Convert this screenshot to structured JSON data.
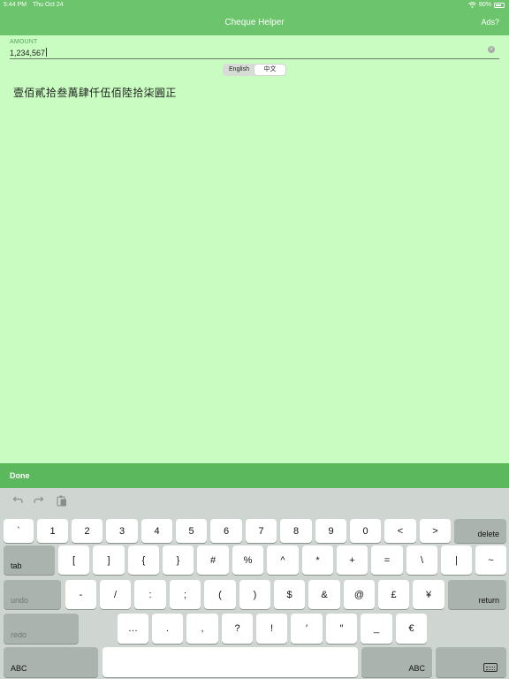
{
  "status": {
    "time": "5:44 PM",
    "date": "Thu Oct 24",
    "battery_label": "80%",
    "battery_level": 0.8,
    "wifi_icon": "wifi-icon"
  },
  "nav": {
    "title": "Cheque Helper",
    "ads": "Ads?"
  },
  "amount": {
    "label": "AMOUNT",
    "value": "1,234,567"
  },
  "language": {
    "options": [
      "English",
      "中文"
    ],
    "selected": "中文"
  },
  "result": "壹佰貳拾叁萬肆仟伍佰陸拾柒圓正",
  "accessory": {
    "done": "Done"
  },
  "keyboard": {
    "toolbar_icons": [
      "undo-icon",
      "redo-icon",
      "paste-icon"
    ],
    "rows": [
      [
        "`",
        "1",
        "2",
        "3",
        "4",
        "5",
        "6",
        "7",
        "8",
        "9",
        "0",
        "<",
        ">"
      ],
      [
        "[",
        "]",
        "{",
        "}",
        "#",
        "%",
        "^",
        "*",
        "+",
        "=",
        "\\",
        "|",
        "~"
      ],
      [
        "-",
        "/",
        ":",
        ";",
        "(",
        ")",
        "$",
        "&",
        "@",
        "£",
        "¥"
      ],
      [
        "…",
        ".",
        ",",
        "?",
        "!",
        "′",
        "″",
        "_",
        "€"
      ]
    ],
    "delete": "delete",
    "tab": "tab",
    "undo": "undo",
    "return": "return",
    "redo": "redo",
    "abc_left": "ABC",
    "abc_right": "ABC"
  },
  "colors": {
    "nav": "#6cc46c",
    "background": "#c8fcc0",
    "done_bar": "#5cb85c",
    "keyboard": "#cfd6d1"
  }
}
